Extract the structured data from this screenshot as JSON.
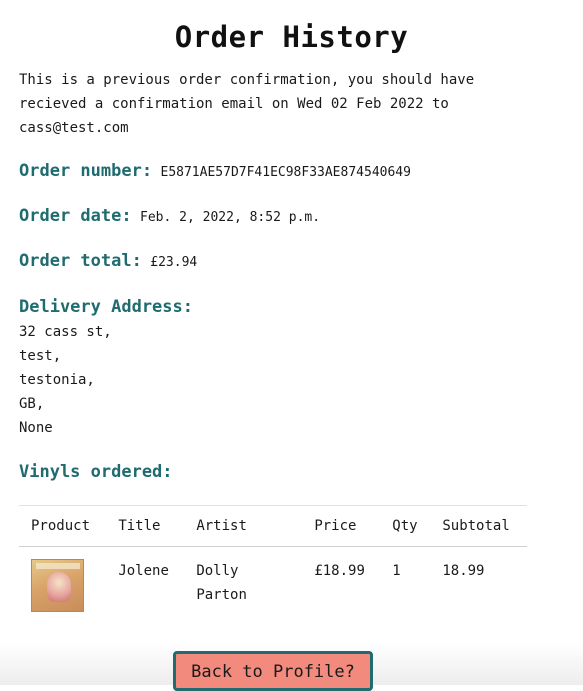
{
  "header": {
    "title": "Order History"
  },
  "intro": "This is a previous order confirmation, you should have recieved a confirmation email on Wed 02 Feb 2022 to cass@test.com",
  "order": {
    "number_label": "Order number:",
    "number_value": "E5871AE57D7F41EC98F33AE874540649",
    "date_label": "Order date:",
    "date_value": "Feb. 2, 2022, 8:52 p.m.",
    "total_label": "Order total:",
    "total_value": "£23.94"
  },
  "delivery": {
    "heading": "Delivery Address:",
    "lines": [
      "32 cass st,",
      "test,",
      "testonia,",
      "GB,",
      "None"
    ]
  },
  "vinyls": {
    "heading": "Vinyls ordered:",
    "columns": [
      "Product",
      "Title",
      "Artist",
      "Price",
      "Qty",
      "Subtotal"
    ],
    "rows": [
      {
        "product_image": "album-cover",
        "title": "Jolene",
        "artist": "Dolly Parton",
        "price": "£18.99",
        "qty": "1",
        "subtotal": "18.99"
      }
    ]
  },
  "actions": {
    "back_label": "Back to Profile?"
  },
  "colors": {
    "accent": "#1f6b6f",
    "button_bg": "#f28b7d"
  }
}
